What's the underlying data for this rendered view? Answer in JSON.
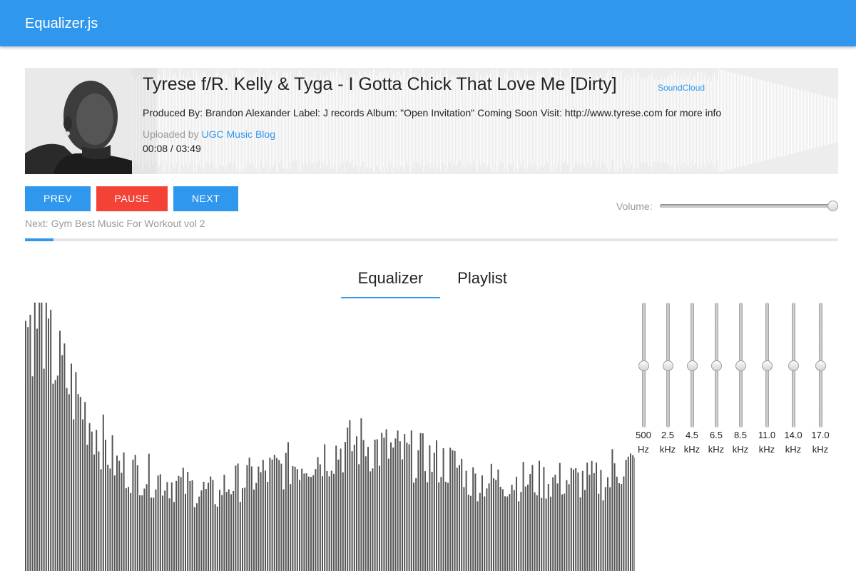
{
  "header": {
    "title": "Equalizer.js",
    "bar_color": "#2f97ee"
  },
  "track": {
    "title": "Tyrese f/R. Kelly & Tyga - I Gotta Chick That Love Me [Dirty]",
    "source_label": "SoundCloud",
    "description": "Produced By: Brandon Alexander   Label: J records  Album: \"Open Invitation\" Coming Soon  Visit: http://www.tyrese.com for more info",
    "uploaded_prefix": "Uploaded by ",
    "uploader": "UGC Music Blog",
    "time": "00:08 / 03:49",
    "progress_fraction": 0.035
  },
  "controls": {
    "prev_label": "PREV",
    "pause_label": "PAUSE",
    "next_label": "NEXT"
  },
  "next_up": "Next: Gym Best Music For Workout vol 2",
  "volume": {
    "label": "Volume:",
    "value_fraction": 1.0
  },
  "tabs": [
    {
      "label": "Equalizer",
      "active": true
    },
    {
      "label": "Playlist",
      "active": false
    }
  ],
  "equalizer": {
    "bands": [
      {
        "value": "500",
        "unit": "Hz",
        "level_fraction": 0.5
      },
      {
        "value": "2.5",
        "unit": "kHz",
        "level_fraction": 0.5
      },
      {
        "value": "4.5",
        "unit": "kHz",
        "level_fraction": 0.5
      },
      {
        "value": "6.5",
        "unit": "kHz",
        "level_fraction": 0.5
      },
      {
        "value": "8.5",
        "unit": "kHz",
        "level_fraction": 0.5
      },
      {
        "value": "11.0",
        "unit": "kHz",
        "level_fraction": 0.5
      },
      {
        "value": "14.0",
        "unit": "kHz",
        "level_fraction": 0.5
      },
      {
        "value": "17.0",
        "unit": "kHz",
        "level_fraction": 0.5
      }
    ]
  },
  "colors": {
    "accent": "#2f97ee",
    "danger": "#f44336",
    "muted": "#9a9a9a",
    "spectrum_bar": "#555555"
  }
}
